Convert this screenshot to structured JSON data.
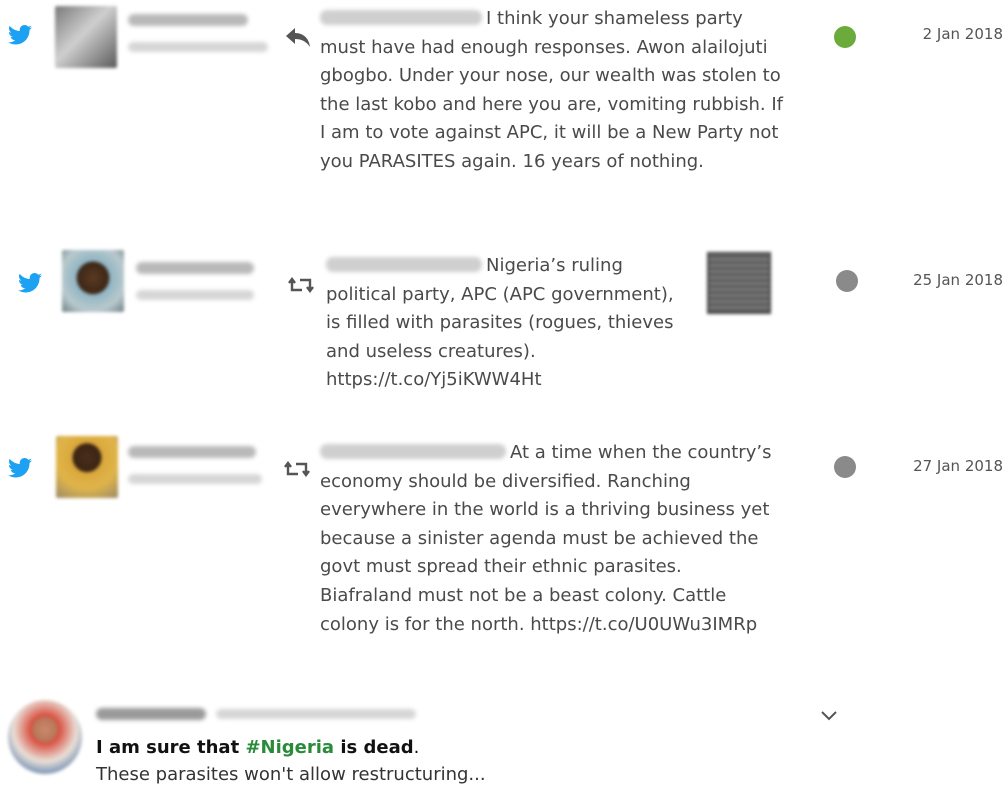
{
  "colors": {
    "twitter_blue": "#1da1f2",
    "green_dot": "#6aab3c",
    "grey_dot": "#8a8a8a",
    "hashtag": "#2a8a3a"
  },
  "rows": [
    {
      "platform_icon": "twitter-icon",
      "action_icon": "reply-icon",
      "text": "I think your shameless party must have had enough responses. Awon alailojuti gbogbo. Under your nose, our wealth was stolen to the last kobo and here you are, vomiting rubbish. If I am to vote against APC, it will be a New Party not you PARASITES again. 16 years of nothing.",
      "status": "green",
      "date": "2 Jan 2018"
    },
    {
      "platform_icon": "twitter-icon",
      "action_icon": "retweet-icon",
      "text": "Nigeria’s ruling political party, APC (APC government), is filled with parasites (rogues, thieves and useless creatures). https://t.co/Yj5iKWW4Ht",
      "status": "grey",
      "date": "25 Jan 2018"
    },
    {
      "platform_icon": "twitter-icon",
      "action_icon": "retweet-icon",
      "text": "At a time when the country’s economy should be diversified. Ranching everywhere in the world is a thriving business yet because a sinister agenda must be achieved the govt must spread their ethnic parasites. Biafraland must not be a beast colony. Cattle colony is for the north. https://t.co/U0UWu3IMRp",
      "status": "grey",
      "date": "27 Jan 2018"
    }
  ],
  "embed": {
    "line1_prefix": "I am sure that ",
    "hashtag": "#Nigeria",
    "line1_suffix": " is dead",
    "line1_end": ".",
    "line2": "These parasites won't allow restructuring...",
    "menu_icon": "chevron-down-icon"
  }
}
